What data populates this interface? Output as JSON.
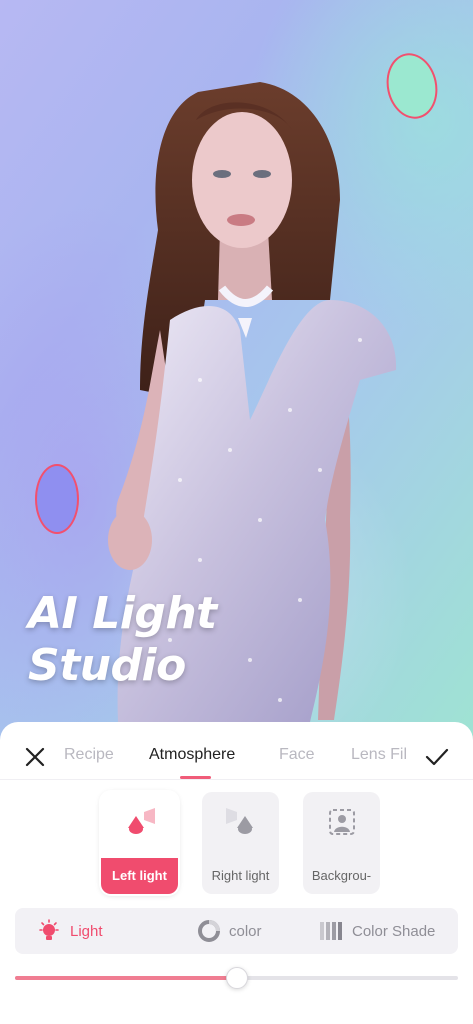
{
  "photo": {
    "watermark_line1": "AI Light",
    "watermark_line2": "Studio"
  },
  "tabs": [
    {
      "label": "Recipe",
      "active": false
    },
    {
      "label": "Atmosphere",
      "active": true
    },
    {
      "label": "Face",
      "active": false
    },
    {
      "label": "Lens Fil",
      "active": false
    }
  ],
  "cards": [
    {
      "label": "Left light",
      "icon": "left-light-icon",
      "selected": true
    },
    {
      "label": "Right light",
      "icon": "right-light-icon",
      "selected": false
    },
    {
      "label": "Backgrou-",
      "icon": "background-light-icon",
      "selected": false
    }
  ],
  "modes": [
    {
      "label": "Light",
      "icon": "bulb-icon",
      "active": true
    },
    {
      "label": "color",
      "icon": "color-wheel-icon",
      "active": false
    },
    {
      "label": "Color Shade",
      "icon": "shade-bars-icon",
      "active": false
    }
  ],
  "slider": {
    "value": 0.5
  },
  "colors": {
    "accent": "#f04c6e",
    "handle_top": "#9be8d0",
    "handle_left": "#8f8ff0"
  }
}
